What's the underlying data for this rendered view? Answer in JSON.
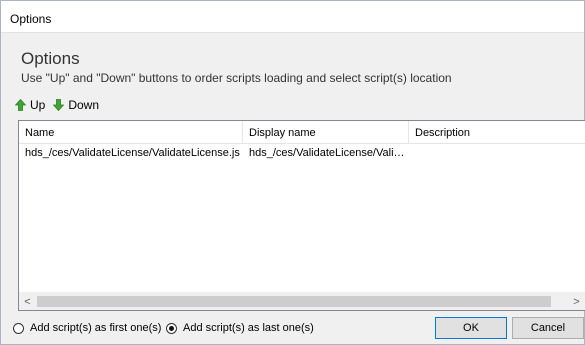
{
  "window": {
    "title": "Options"
  },
  "header": {
    "title": "Options",
    "description": "Use \"Up\" and \"Down\" buttons to order scripts loading and select script(s) location"
  },
  "toolbar": {
    "up_label": "Up",
    "down_label": "Down",
    "up_icon": "up-arrow-icon",
    "down_icon": "down-arrow-icon",
    "icon_color": "#3fa535"
  },
  "list": {
    "columns": [
      "Name",
      "Display name",
      "Description"
    ],
    "rows": [
      [
        "hds_/ces/ValidateLicense/ValidateLicense.js",
        "hds_/ces/ValidateLicense/Valida...",
        ""
      ]
    ]
  },
  "scroll": {
    "left": "<",
    "right": ">"
  },
  "options": {
    "first_label": "Add script(s) as first one(s)",
    "last_label": "Add script(s) as last one(s)",
    "selected": "last"
  },
  "buttons": {
    "ok": "OK",
    "cancel": "Cancel"
  }
}
